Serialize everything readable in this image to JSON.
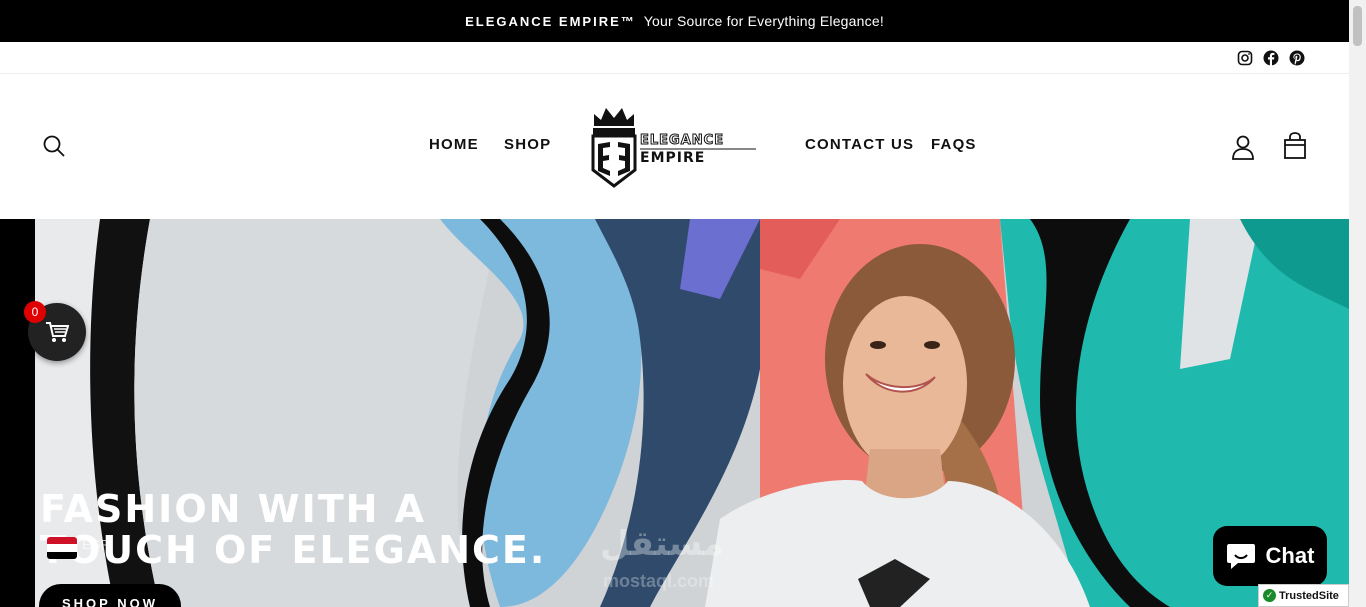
{
  "announcement": {
    "brand": "ELEGANCE EMPIRE™",
    "text": "Your Source for Everything Elegance!"
  },
  "social": {
    "icons": [
      "instagram-icon",
      "facebook-icon",
      "pinterest-icon"
    ]
  },
  "nav": {
    "home": "HOME",
    "shop": "SHOP",
    "contact": "CONTACT US",
    "faqs": "FAQS"
  },
  "logo": {
    "line1": "ELEGANCE",
    "line2": "EMPIRE",
    "monogram": "EE"
  },
  "hero": {
    "title_line1": "FASHION WITH A",
    "title_line2": "TOUCH OF ELEGANCE.",
    "cta": "SHOP NOW"
  },
  "floating_cart": {
    "count": "0"
  },
  "currency": {
    "label": "EGP"
  },
  "chat": {
    "label": "Chat"
  },
  "trusted": {
    "label": "TrustedSite"
  },
  "watermark": {
    "arabic": "مستقل",
    "latin": "mostaql.com"
  },
  "colors": {
    "accent_red": "#e10000",
    "announcement_bg": "#000000",
    "chat_bg": "#000000"
  }
}
